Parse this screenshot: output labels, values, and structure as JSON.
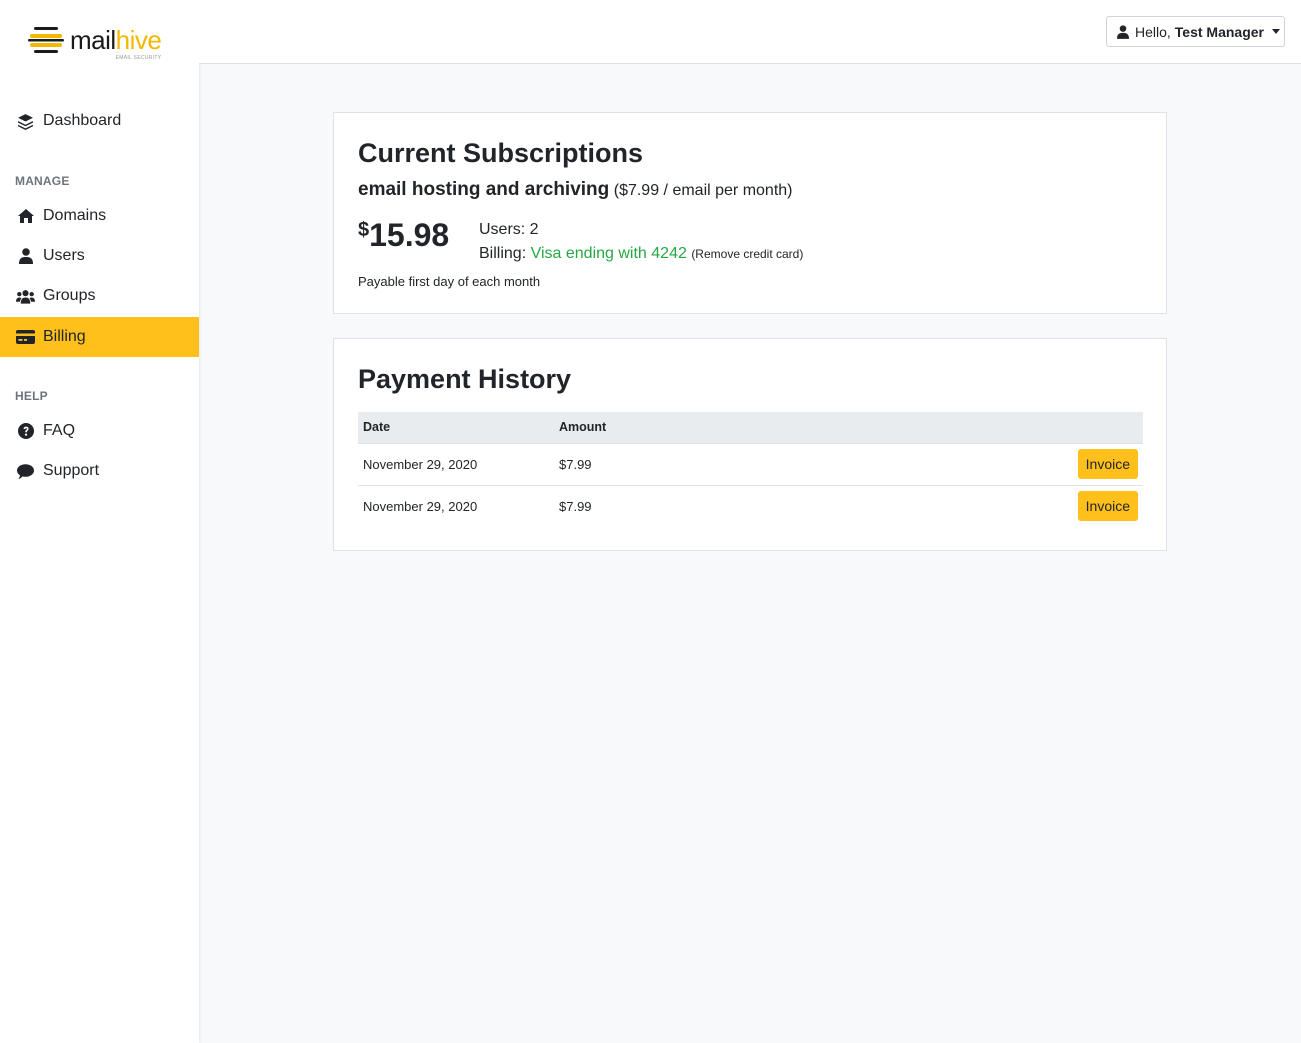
{
  "app": {
    "logo_mail": "mail",
    "logo_hive": "hive",
    "logo_tagline": "EMAIL SECURITY"
  },
  "sidebar": {
    "dashboard": {
      "label": "Dashboard",
      "icon": "layers-icon"
    },
    "manage_heading": "MANAGE",
    "manage_items": [
      {
        "label": "Domains",
        "icon": "home-icon"
      },
      {
        "label": "Users",
        "icon": "user-icon"
      },
      {
        "label": "Groups",
        "icon": "users-icon"
      },
      {
        "label": "Billing",
        "icon": "credit-card-icon",
        "active": true
      }
    ],
    "help_heading": "HELP",
    "help_items": [
      {
        "label": "FAQ",
        "icon": "question-circle-icon"
      },
      {
        "label": "Support",
        "icon": "comment-icon"
      }
    ]
  },
  "header": {
    "greeting": "Hello,",
    "user_name": "Test Manager"
  },
  "subscription": {
    "title": "Current Subscriptions",
    "plan_name": "email hosting and archiving",
    "plan_rate": "($7.99 / email per month)",
    "currency": "$",
    "amount": "15.98",
    "users": "Users: 2",
    "billing_label": "Billing:",
    "card_info": "Visa ending with 4242",
    "remove_card": "(Remove credit card)",
    "payable_note": "Payable first day of each month"
  },
  "payment_history": {
    "title": "Payment History",
    "columns": [
      "Date",
      "Amount"
    ],
    "rows": [
      {
        "date": "November 29, 2020",
        "amount": "$7.99",
        "action": "Invoice"
      },
      {
        "date": "November 29, 2020",
        "amount": "$7.99",
        "action": "Invoice"
      }
    ]
  },
  "colors": {
    "accent": "#ffc01c",
    "success": "#28a745",
    "background": "#f8f9fa"
  }
}
